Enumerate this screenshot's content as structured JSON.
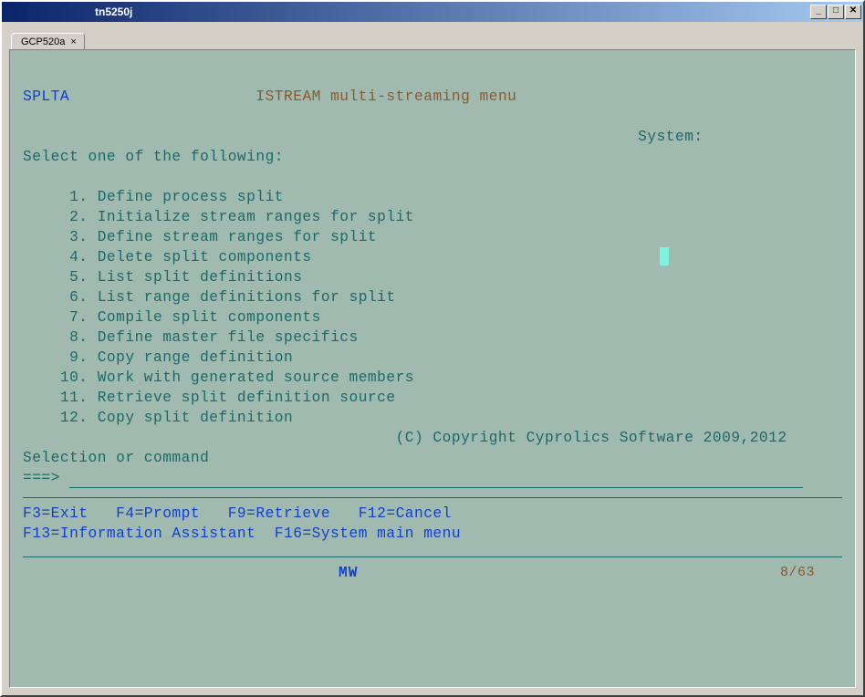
{
  "window": {
    "title": "tn5250j"
  },
  "tab": {
    "label": "GCP520a",
    "close_glyph": "×"
  },
  "screen": {
    "id": "SPLTA",
    "title": "ISTREAM multi-streaming menu",
    "system_label": "System:",
    "prompt": "Select one of the following:",
    "options": [
      {
        "num": " 1",
        "text": "Define process split"
      },
      {
        "num": " 2",
        "text": "Initialize stream ranges for split"
      },
      {
        "num": " 3",
        "text": "Define stream ranges for split"
      },
      {
        "num": " 4",
        "text": "Delete split components"
      },
      {
        "num": " 5",
        "text": "List split definitions"
      },
      {
        "num": " 6",
        "text": "List range definitions for split"
      },
      {
        "num": " 7",
        "text": "Compile split components"
      },
      {
        "num": " 8",
        "text": "Define master file specifics"
      },
      {
        "num": " 9",
        "text": "Copy range definition"
      },
      {
        "num": "10",
        "text": "Work with generated source members"
      },
      {
        "num": "11",
        "text": "Retrieve split definition source"
      },
      {
        "num": "12",
        "text": "Copy split definition"
      }
    ],
    "copyright": "(C) Copyright Cyprolics Software 2009,2012",
    "sel_label": "Selection or command",
    "arrow": "===>",
    "fk_line1": "F3=Exit   F4=Prompt   F9=Retrieve   F12=Cancel",
    "fk_line2": "F13=Information Assistant  F16=System main menu",
    "status_mw": "MW",
    "cursor_pos": "8/63"
  }
}
